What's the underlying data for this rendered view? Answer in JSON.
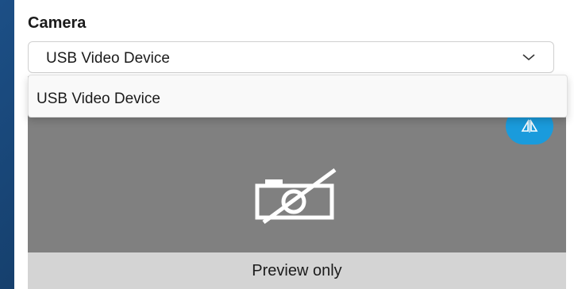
{
  "camera": {
    "label": "Camera",
    "selected": "USB Video Device",
    "options": [
      "USB Video Device"
    ]
  },
  "preview": {
    "footer_text": "Preview only",
    "flip_icon": "flip-horizontal-icon",
    "status_icon": "camera-off-icon"
  },
  "colors": {
    "accent": "#1a9bdc",
    "preview_bg": "#808080",
    "footer_bg": "#d4d4d4"
  }
}
